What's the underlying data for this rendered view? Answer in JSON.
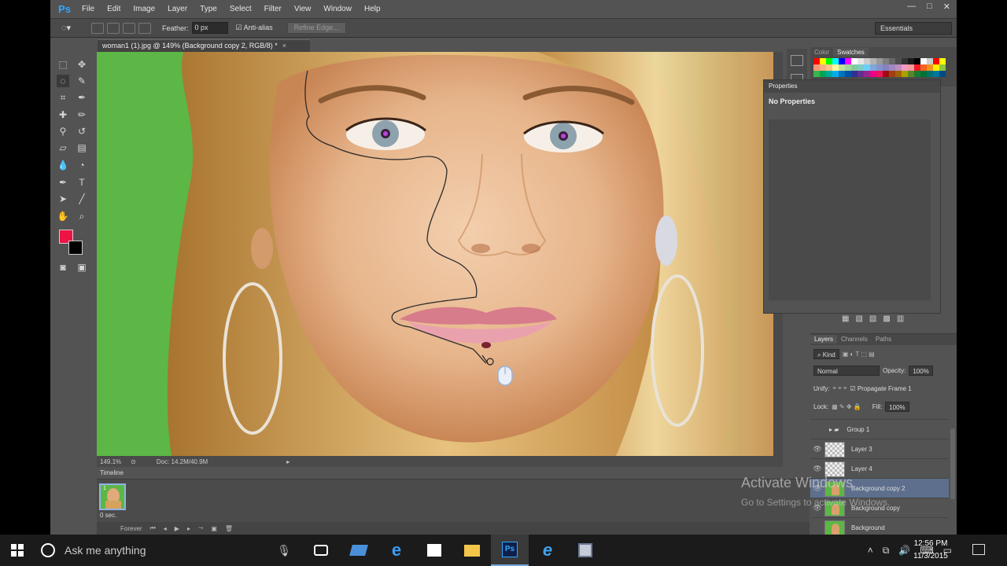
{
  "app": {
    "logo": "Ps",
    "menu": [
      "File",
      "Edit",
      "Image",
      "Layer",
      "Type",
      "Select",
      "Filter",
      "View",
      "Window",
      "Help"
    ],
    "window_controls": [
      "—",
      "□",
      "✕"
    ]
  },
  "options_bar": {
    "feather_label": "Feather:",
    "feather_value": "0 px",
    "antialias_label": "Anti-alias",
    "refine_edge_label": "Refine Edge...",
    "workspace": "Essentials"
  },
  "document": {
    "tab_title": "woman1 (1).jpg @ 149% (Background copy 2, RGB/8) *",
    "zoom": "149.1%",
    "doc_size": "Doc: 14.2M/40.9M"
  },
  "timeline": {
    "tab_label": "Timeline",
    "frame_number": "1",
    "frame_delay": "0 sec.",
    "loop": "Forever"
  },
  "swatches_panel": {
    "tabs": [
      "Color",
      "Swatches"
    ],
    "active_tab": "Swatches"
  },
  "properties_panel": {
    "header": "Properties",
    "title": "No Properties"
  },
  "layers_panel": {
    "tabs": [
      "Layers",
      "Channels",
      "Paths"
    ],
    "filter_kind": "Kind",
    "blend_mode": "Normal",
    "opacity_label": "Opacity:",
    "opacity_value": "100%",
    "unify_label": "Unify:",
    "propagate_label": "Propagate Frame 1",
    "lock_label": "Lock:",
    "fill_label": "Fill:",
    "fill_value": "100%",
    "layers": [
      {
        "name": "Group 1",
        "kind": "group",
        "visible": false,
        "selected": false
      },
      {
        "name": "Layer 3",
        "kind": "checker",
        "visible": true,
        "selected": false
      },
      {
        "name": "Layer 4",
        "kind": "checker",
        "visible": true,
        "selected": false
      },
      {
        "name": "Background copy 2",
        "kind": "photo",
        "visible": true,
        "selected": true
      },
      {
        "name": "Background copy",
        "kind": "photo",
        "visible": true,
        "selected": false
      },
      {
        "name": "Background",
        "kind": "photo",
        "visible": false,
        "selected": false
      }
    ]
  },
  "watermark": {
    "title": "Activate Windows",
    "subtitle": "Go to Settings to activate Windows."
  },
  "taskbar": {
    "search_placeholder": "Ask me anything",
    "time": "12:56 PM",
    "date": "11/3/2015"
  },
  "colors": {
    "foreground": "#ed1445",
    "background": "#000000",
    "canvas_green": "#5cb746",
    "selected_layer": "#5e6f8e"
  }
}
